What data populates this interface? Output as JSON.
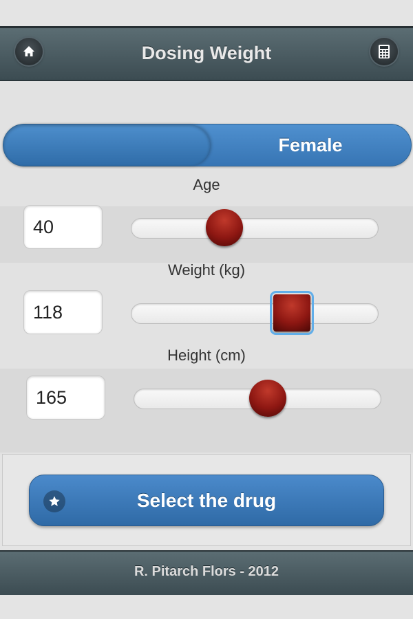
{
  "header": {
    "title": "Dosing Weight",
    "left_icon": "home-icon",
    "right_icon": "calculator-icon"
  },
  "sex_toggle": {
    "options": [
      "",
      "Female"
    ],
    "selected": "Male side (left) highlighted"
  },
  "fields": [
    {
      "label": "Age",
      "value": "40",
      "slider_fraction": 0.38
    },
    {
      "label": "Weight (kg)",
      "value": "118",
      "slider_fraction": 0.68
    },
    {
      "label": "Height (cm)",
      "value": "165",
      "slider_fraction": 0.55
    }
  ],
  "action": {
    "label": "Select the drug",
    "icon": "star-icon"
  },
  "footer": {
    "text": "R. Pitarch Flors - 2012"
  },
  "colors": {
    "header_bg": "#4a5b61",
    "accent_blue": "#3f7fbf",
    "slider_thumb": "#8d1712"
  }
}
